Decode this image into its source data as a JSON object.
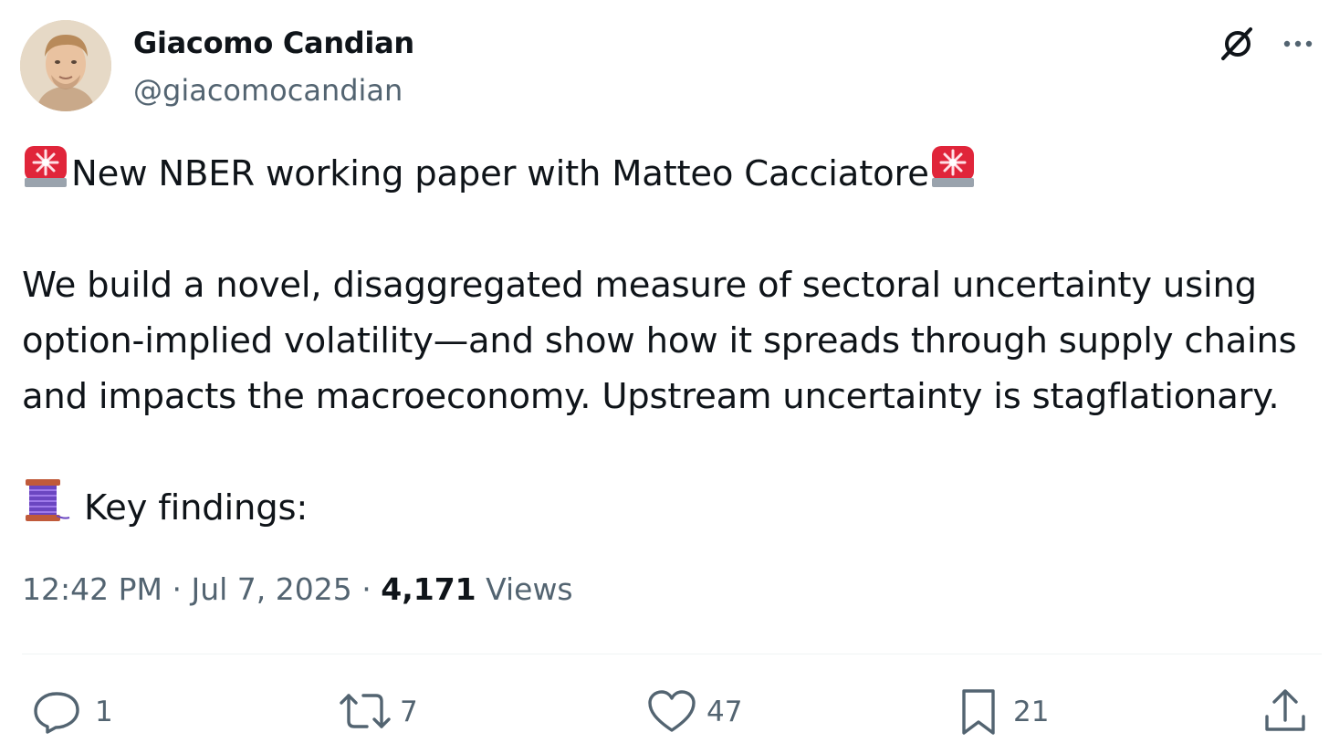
{
  "author": {
    "name": "Giacomo Candian",
    "handle": "@giacomocandian",
    "avatar_icon": "avatar-photo"
  },
  "header_icons": [
    "grok-icon",
    "more-icon"
  ],
  "tweet": {
    "line1": "New NBER working paper with Matteo Cacciatore",
    "line1_emoji": "rotating-light-icon",
    "body_lines": [
      "We build a novel, disaggregated measure of sectoral uncertainty using",
      "option-implied volatility—and show how it spreads through supply chains",
      "and impacts the macroeconomy. Upstream uncertainty is stagflationary."
    ],
    "findings": "Key findings:",
    "findings_emoji": "thread-spool-icon"
  },
  "meta": {
    "time": "12:42 PM",
    "separator": "·",
    "date": "Jul 7, 2025",
    "views_count": "4,171",
    "views_label": "Views"
  },
  "actions": {
    "replies": "1",
    "reposts": "7",
    "likes": "47",
    "bookmarks": "21"
  },
  "colors": {
    "text": "#0f1419",
    "secondary": "#536471",
    "divider": "#eff3f4",
    "siren_red": "#e0253a",
    "spool_purple": "#6b46c1"
  }
}
